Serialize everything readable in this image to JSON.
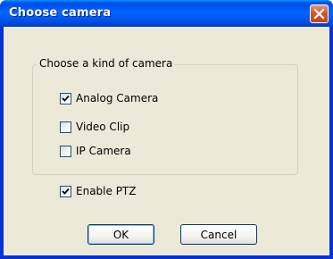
{
  "window": {
    "title": "Choose camera"
  },
  "camera_group": {
    "legend": "Choose a kind of camera",
    "options": [
      {
        "label": "Analog Camera",
        "checked": true
      },
      {
        "label": "Video Clip",
        "checked": false
      },
      {
        "label": "IP Camera",
        "checked": false
      }
    ]
  },
  "ptz": {
    "label": "Enable PTZ",
    "checked": true
  },
  "buttons": {
    "ok_label": "OK",
    "cancel_label": "Cancel"
  },
  "icons": {
    "close": "close-icon",
    "check": "checkmark-icon"
  },
  "colors": {
    "titlebar": "#0054e3",
    "close_button": "#d5562b",
    "client_background": "#ece9d8",
    "checkbox_border": "#1c5180"
  }
}
